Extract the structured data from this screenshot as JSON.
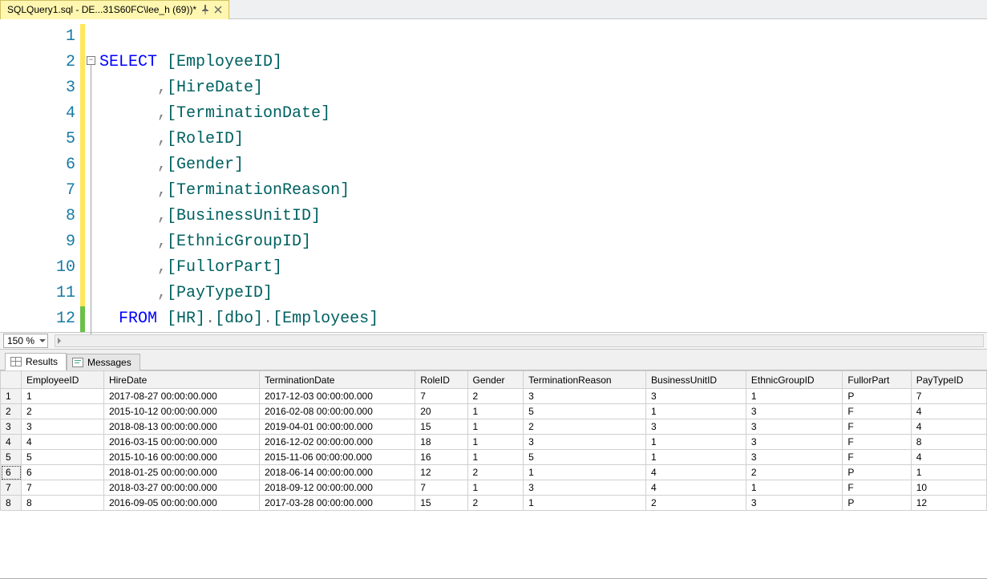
{
  "doc_tab": {
    "title": "SQLQuery1.sql - DE...31S60FC\\lee_h (69))*",
    "pin_icon": "pin-icon",
    "close_icon": "close-icon"
  },
  "editor": {
    "line_count": 12,
    "zoom": "150 %",
    "fold_glyph": "−",
    "lines": [
      {
        "n": 1,
        "state": "yel",
        "tokens": []
      },
      {
        "n": 2,
        "state": "yel",
        "tokens": [
          {
            "t": "kw",
            "v": "SELECT"
          },
          {
            "t": "plain",
            "v": " "
          },
          {
            "t": "id",
            "v": "[EmployeeID]"
          }
        ]
      },
      {
        "n": 3,
        "state": "yel",
        "tokens": [
          {
            "t": "plain",
            "v": "      "
          },
          {
            "t": "op",
            "v": ","
          },
          {
            "t": "id",
            "v": "[HireDate]"
          }
        ]
      },
      {
        "n": 4,
        "state": "yel",
        "tokens": [
          {
            "t": "plain",
            "v": "      "
          },
          {
            "t": "op",
            "v": ","
          },
          {
            "t": "id",
            "v": "[TerminationDate]"
          }
        ]
      },
      {
        "n": 5,
        "state": "yel",
        "tokens": [
          {
            "t": "plain",
            "v": "      "
          },
          {
            "t": "op",
            "v": ","
          },
          {
            "t": "id",
            "v": "[RoleID]"
          }
        ]
      },
      {
        "n": 6,
        "state": "yel",
        "tokens": [
          {
            "t": "plain",
            "v": "      "
          },
          {
            "t": "op",
            "v": ","
          },
          {
            "t": "id",
            "v": "[Gender]"
          }
        ]
      },
      {
        "n": 7,
        "state": "yel",
        "tokens": [
          {
            "t": "plain",
            "v": "      "
          },
          {
            "t": "op",
            "v": ","
          },
          {
            "t": "id",
            "v": "[TerminationReason]"
          }
        ]
      },
      {
        "n": 8,
        "state": "yel",
        "tokens": [
          {
            "t": "plain",
            "v": "      "
          },
          {
            "t": "op",
            "v": ","
          },
          {
            "t": "id",
            "v": "[BusinessUnitID]"
          }
        ]
      },
      {
        "n": 9,
        "state": "yel",
        "tokens": [
          {
            "t": "plain",
            "v": "      "
          },
          {
            "t": "op",
            "v": ","
          },
          {
            "t": "id",
            "v": "[EthnicGroupID]"
          }
        ]
      },
      {
        "n": 10,
        "state": "yel",
        "tokens": [
          {
            "t": "plain",
            "v": "      "
          },
          {
            "t": "op",
            "v": ","
          },
          {
            "t": "id",
            "v": "[FullorPart]"
          }
        ]
      },
      {
        "n": 11,
        "state": "yel",
        "tokens": [
          {
            "t": "plain",
            "v": "      "
          },
          {
            "t": "op",
            "v": ","
          },
          {
            "t": "id",
            "v": "[PayTypeID]"
          }
        ]
      },
      {
        "n": 12,
        "state": "grn",
        "tokens": [
          {
            "t": "plain",
            "v": "  "
          },
          {
            "t": "kw",
            "v": "FROM"
          },
          {
            "t": "plain",
            "v": " "
          },
          {
            "t": "id",
            "v": "[HR]"
          },
          {
            "t": "op",
            "v": "."
          },
          {
            "t": "id",
            "v": "[dbo]"
          },
          {
            "t": "op",
            "v": "."
          },
          {
            "t": "id",
            "v": "[Employees]"
          }
        ]
      }
    ]
  },
  "results": {
    "tabs": {
      "results": "Results",
      "messages": "Messages"
    },
    "columns": [
      "EmployeeID",
      "HireDate",
      "TerminationDate",
      "RoleID",
      "Gender",
      "TerminationReason",
      "BusinessUnitID",
      "EthnicGroupID",
      "FullorPart",
      "PayTypeID"
    ],
    "selected_row_index": 5,
    "rows": [
      [
        "1",
        "2017-08-27 00:00:00.000",
        "2017-12-03 00:00:00.000",
        "7",
        "2",
        "3",
        "3",
        "1",
        "P",
        "7"
      ],
      [
        "2",
        "2015-10-12 00:00:00.000",
        "2016-02-08 00:00:00.000",
        "20",
        "1",
        "5",
        "1",
        "3",
        "F",
        "4"
      ],
      [
        "3",
        "2018-08-13 00:00:00.000",
        "2019-04-01 00:00:00.000",
        "15",
        "1",
        "2",
        "3",
        "3",
        "F",
        "4"
      ],
      [
        "4",
        "2016-03-15 00:00:00.000",
        "2016-12-02 00:00:00.000",
        "18",
        "1",
        "3",
        "1",
        "3",
        "F",
        "8"
      ],
      [
        "5",
        "2015-10-16 00:00:00.000",
        "2015-11-06 00:00:00.000",
        "16",
        "1",
        "5",
        "1",
        "3",
        "F",
        "4"
      ],
      [
        "6",
        "2018-01-25 00:00:00.000",
        "2018-06-14 00:00:00.000",
        "12",
        "2",
        "1",
        "4",
        "2",
        "P",
        "1"
      ],
      [
        "7",
        "2018-03-27 00:00:00.000",
        "2018-09-12 00:00:00.000",
        "7",
        "1",
        "3",
        "4",
        "1",
        "F",
        "10"
      ],
      [
        "8",
        "2016-09-05 00:00:00.000",
        "2017-03-28 00:00:00.000",
        "15",
        "2",
        "1",
        "2",
        "3",
        "P",
        "12"
      ]
    ]
  }
}
